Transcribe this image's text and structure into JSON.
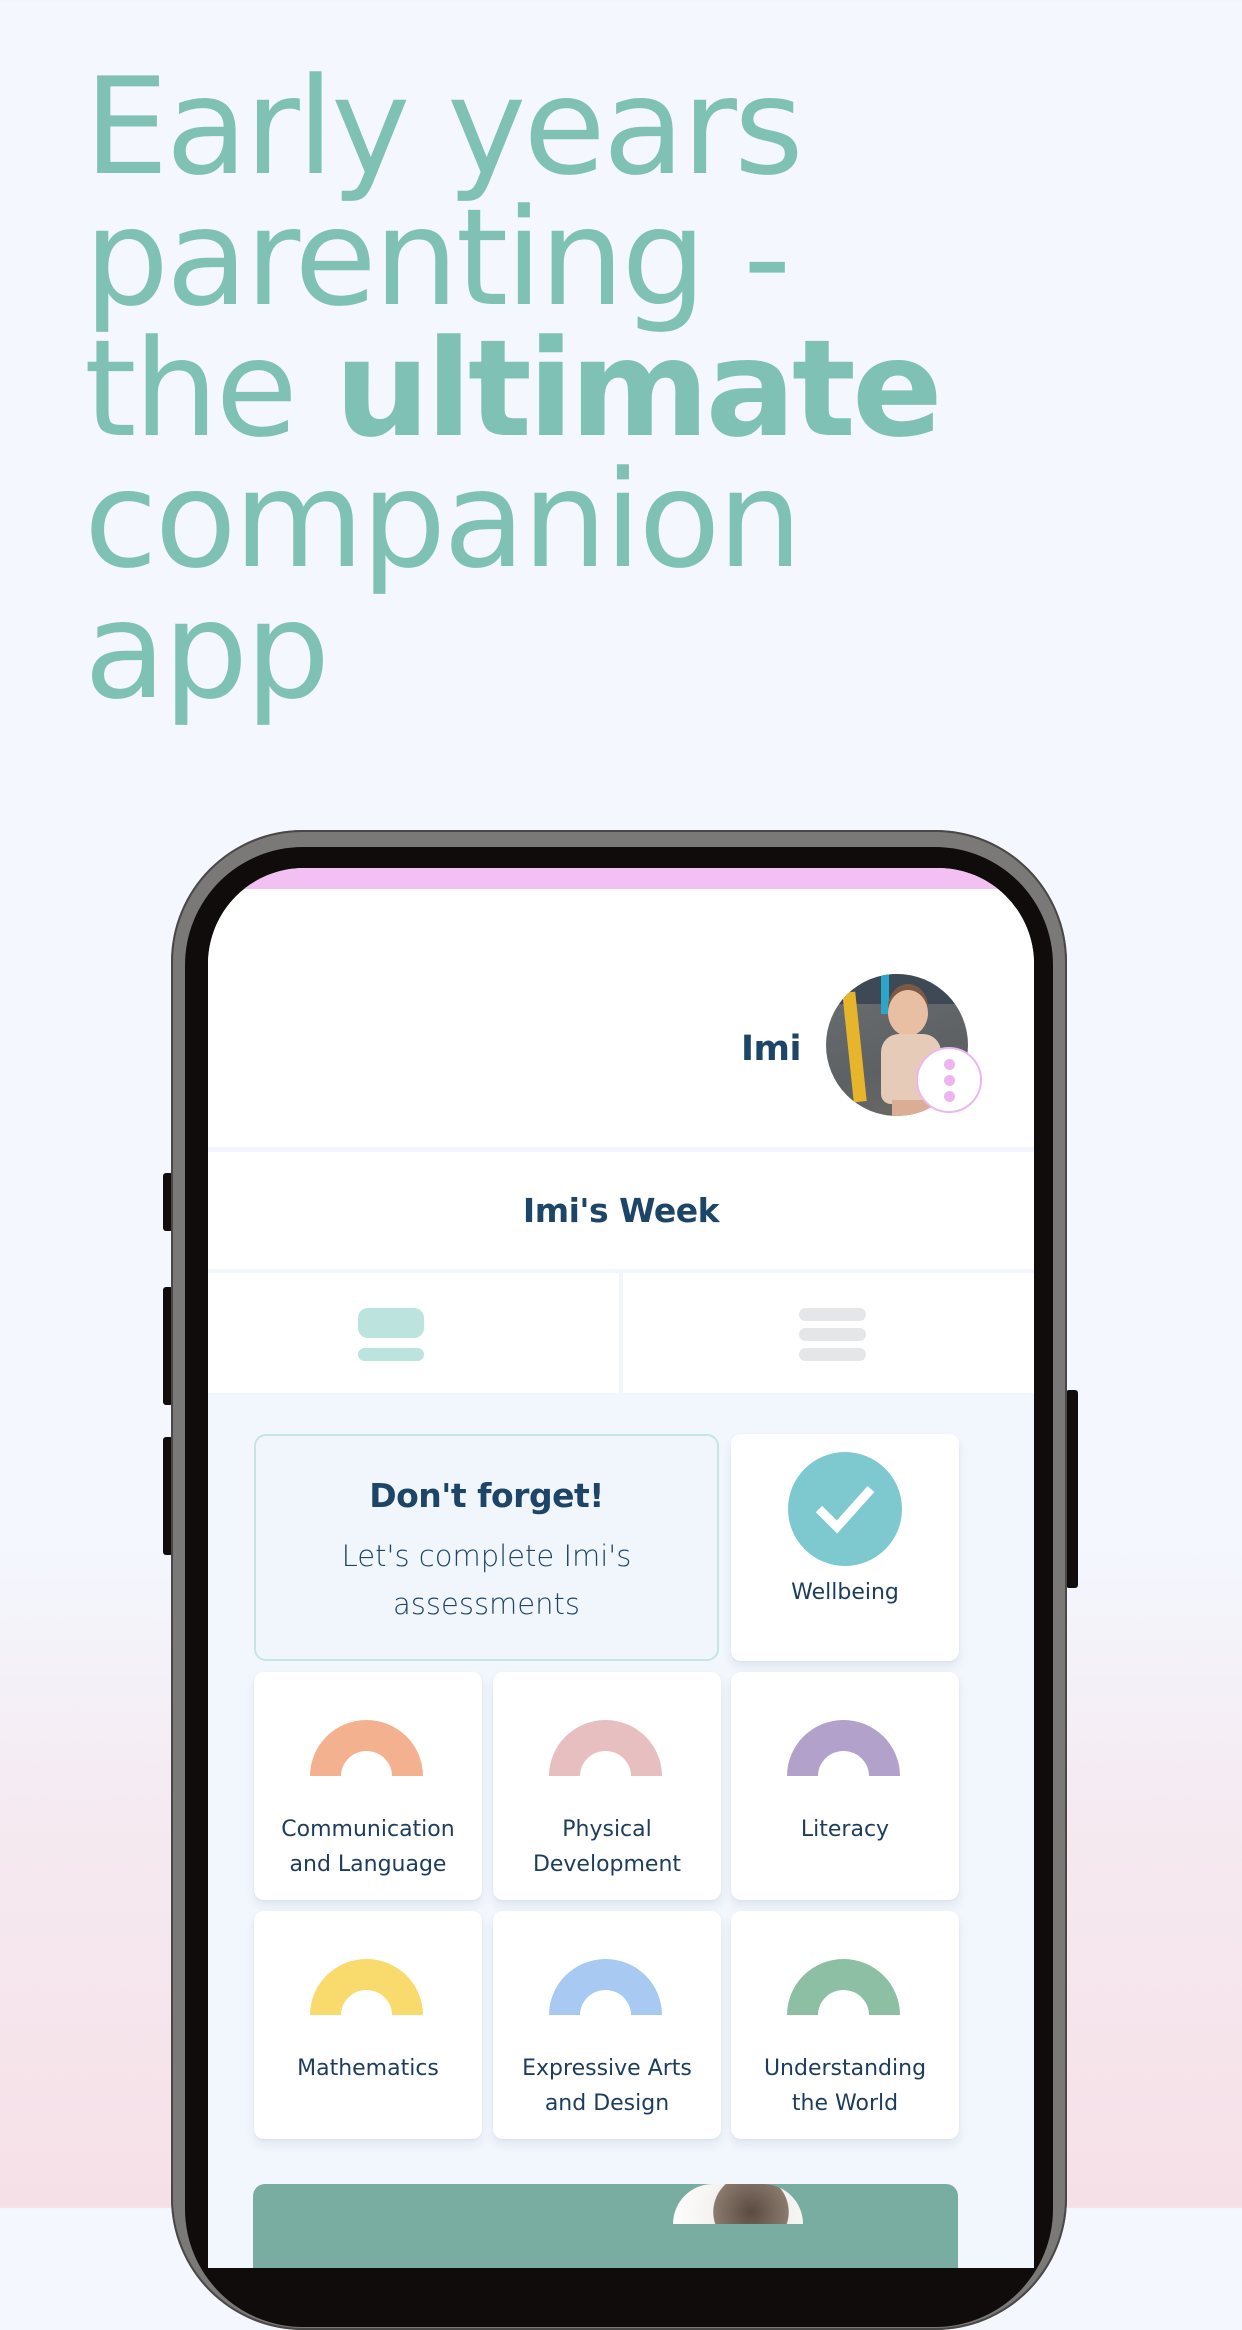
{
  "headline": {
    "lines": [
      "Early years",
      "parenting -",
      "the ",
      "companion",
      "app"
    ],
    "emphasis": "ultimate",
    "color": "#7fc2b5"
  },
  "app": {
    "accent_pink": "#f2c0f2",
    "text_color": "#1d4567",
    "profile": {
      "child_name": "Imi",
      "avatar_alt": "child-photo",
      "menu_icon": "more-vertical-icon"
    },
    "week_title": "Imi's Week",
    "view_tabs": [
      {
        "name": "cards-view",
        "icon": "card-view-icon",
        "active": true
      },
      {
        "name": "list-view",
        "icon": "list-view-icon",
        "active": false
      }
    ],
    "reminder": {
      "title": "Don't forget!",
      "body": "Let's complete Imi's assessments"
    },
    "areas": [
      {
        "label": "Wellbeing",
        "icon": "check-circle-icon",
        "color": "#7ec9cf",
        "completed": true
      },
      {
        "label": "Communication and Language",
        "icon": "rainbow-arc-icon",
        "color": "#f4b18f"
      },
      {
        "label": "Physical Development",
        "icon": "rainbow-arc-icon",
        "color": "#e8bfc1"
      },
      {
        "label": "Literacy",
        "icon": "rainbow-arc-icon",
        "color": "#b2a1cb"
      },
      {
        "label": "Mathematics",
        "icon": "rainbow-arc-icon",
        "color": "#f8db6c"
      },
      {
        "label": "Expressive Arts and Design",
        "icon": "rainbow-arc-icon",
        "color": "#a8c9f2"
      },
      {
        "label": "Understanding the World",
        "icon": "rainbow-arc-icon",
        "color": "#8dbfa4"
      }
    ],
    "banner_color": "#7aada1"
  }
}
